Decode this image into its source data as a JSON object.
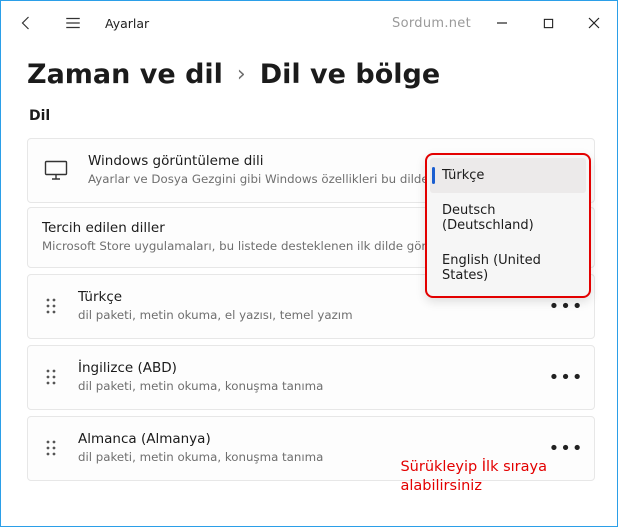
{
  "titlebar": {
    "app_title": "Ayarlar",
    "watermark": "Sordum.net"
  },
  "breadcrumb": {
    "root": "Zaman ve dil",
    "sep": "›",
    "page": "Dil ve bölge"
  },
  "section_label": "Dil",
  "display_language": {
    "title": "Windows görüntüleme dili",
    "desc": "Ayarlar ve Dosya Gezgini gibi Windows özellikleri bu dilde görüntülenecektir."
  },
  "preferred_languages": {
    "title": "Tercih edilen diller",
    "desc": "Microsoft Store uygulamaları, bu listede desteklenen ilk dilde görünür"
  },
  "languages": [
    {
      "name": "Türkçe",
      "features": "dil paketi, metin okuma, el yazısı, temel yazım"
    },
    {
      "name": "İngilizce (ABD)",
      "features": "dil paketi, metin okuma, konuşma tanıma"
    },
    {
      "name": "Almanca (Almanya)",
      "features": "dil paketi, metin okuma, konuşma tanıma"
    }
  ],
  "dropdown": {
    "items": [
      "Türkçe",
      "Deutsch (Deutschland)",
      "English (United States)"
    ]
  },
  "annotation": {
    "line1": "Sürükleyip İlk sıraya",
    "line2": "alabilirsiniz"
  },
  "more_glyph": "•••"
}
